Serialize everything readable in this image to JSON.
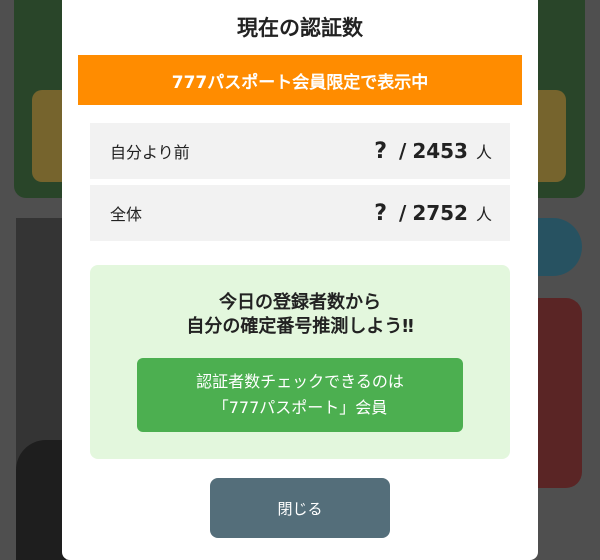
{
  "modal": {
    "title": "現在の認証数",
    "banner": "777パスポート会員限定で表示中",
    "stats": [
      {
        "label": "自分より前",
        "unknown": "?",
        "separator": "/",
        "total": "2453",
        "unit": "人"
      },
      {
        "label": "全体",
        "unknown": "?",
        "separator": "/",
        "total": "2752",
        "unit": "人"
      }
    ],
    "promo": {
      "line1": "今日の登録者数から",
      "line2": "自分の確定番号推測しよう‼",
      "button_line1": "認証者数チェックできるのは",
      "button_line2": "「777パスポート」会員"
    },
    "close_label": "閉じる"
  },
  "colors": {
    "banner": "#ff8c00",
    "promo_bg": "#e3f7dd",
    "promo_button": "#4caf50",
    "close_button": "#546e7a"
  }
}
